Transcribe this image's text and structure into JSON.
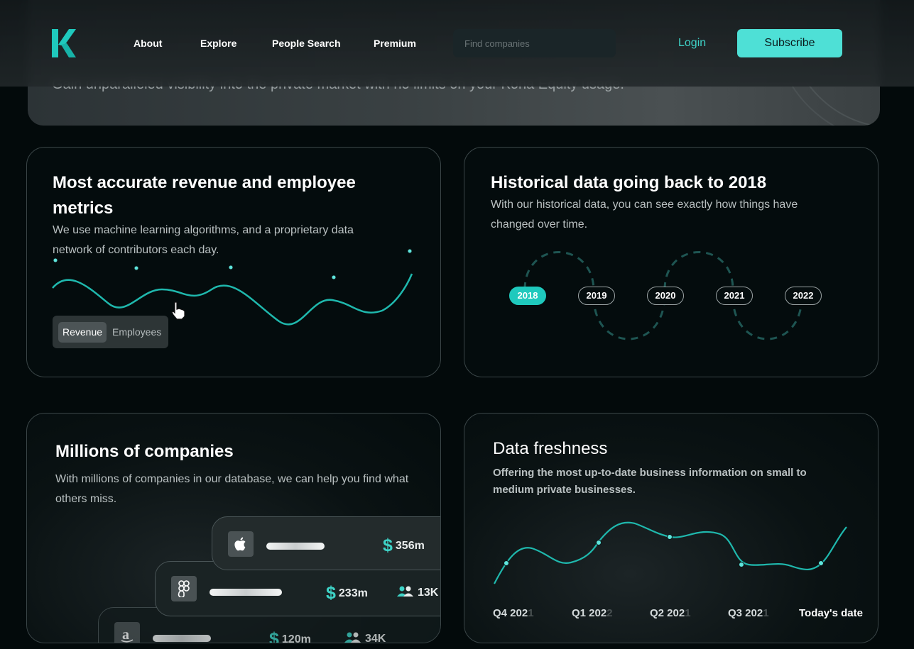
{
  "hero": {
    "subtitle": "Gain unparalleled visibility into the private market with no limits on your Kona Equity usage."
  },
  "header": {
    "nav": [
      "About",
      "Explore",
      "People Search",
      "Premium"
    ],
    "search_placeholder": "Find companies",
    "login_label": "Login",
    "subscribe_label": "Subscribe"
  },
  "card_metrics": {
    "title": "Most accurate revenue and employee metrics",
    "description": "We use machine learning algorithms, and a proprietary data network of contributors each day.",
    "toggle": [
      "Revenue",
      "Employees"
    ],
    "active_toggle": "Revenue"
  },
  "card_history": {
    "title": "Historical data going back to 2018",
    "description": "With our historical data, you can see exactly how things have changed over time.",
    "years": [
      "2018",
      "2019",
      "2020",
      "2021",
      "2022"
    ],
    "active_year": "2018"
  },
  "card_companies": {
    "title": "Millions of companies",
    "description": "With millions of companies in our database, we can help you find what others miss.",
    "rows": [
      {
        "icon": "apple-icon",
        "revenue": "356m",
        "employees": ""
      },
      {
        "icon": "figma-icon",
        "revenue": "233m",
        "employees": "13K"
      },
      {
        "icon": "amazon-icon",
        "revenue": "120m",
        "employees": "34K"
      }
    ],
    "currency_symbol": "$"
  },
  "card_freshness": {
    "title": "Data freshness",
    "description": "Offering the most up-to-date business information on small to medium private businesses.",
    "labels": [
      {
        "main": "Q4 202",
        "fade": "1"
      },
      {
        "main": "Q1 202",
        "fade": "2"
      },
      {
        "main": "Q2 202",
        "fade": "1"
      },
      {
        "main": "Q3 202",
        "fade": "1"
      }
    ],
    "today_label": "Today's date"
  },
  "colors": {
    "accent": "#4ee0d6",
    "accent_dark": "#1fc9bd",
    "background": "#030a0b",
    "card_border": "#3a4547"
  }
}
